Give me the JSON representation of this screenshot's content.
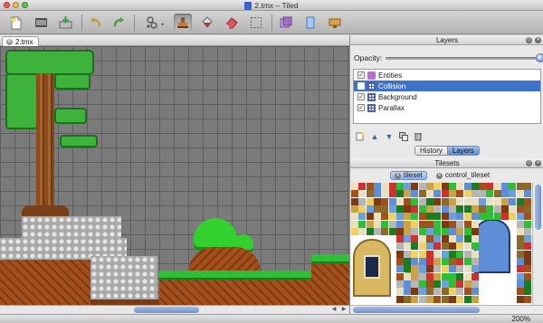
{
  "window": {
    "title": "2.tmx – Tiled",
    "traffic_lights": [
      "#ee5e57",
      "#f4bd4f",
      "#61c454"
    ]
  },
  "toolbar": {
    "tools": [
      {
        "name": "new-file-icon",
        "color": "#f3dc5e"
      },
      {
        "name": "open-file-icon",
        "color": "#4e4e4e"
      },
      {
        "name": "save-file-icon",
        "color": "#3aa04a"
      },
      {
        "name": "undo-icon",
        "color": "#c39c38"
      },
      {
        "name": "redo-icon",
        "color": "#4e9b3b"
      },
      {
        "name": "random-stamp-icon",
        "color": "#555555"
      },
      {
        "name": "stamp-brush-icon",
        "color": "#c97a2b"
      },
      {
        "name": "bucket-fill-icon",
        "color": "#c1343e"
      },
      {
        "name": "eraser-icon",
        "color": "#e2535c"
      },
      {
        "name": "rectangle-select-icon",
        "color": "#8a8a8a"
      },
      {
        "name": "select-objects-icon",
        "color": "#9b6ac2"
      },
      {
        "name": "insert-rectangle-icon",
        "color": "#6aa0dd"
      },
      {
        "name": "insert-tile-icon",
        "color": "#d8a24a"
      }
    ]
  },
  "document": {
    "tab_label": "2.tmx",
    "zoom": "200%"
  },
  "layers_panel": {
    "title": "Layers",
    "opacity_label": "Opacity:",
    "opacity_value": 1.0,
    "layers": [
      {
        "label": "Entities",
        "visible": true,
        "icon": "object-layer-icon",
        "selected": false
      },
      {
        "label": "Collision",
        "visible": false,
        "icon": "tile-layer-icon",
        "selected": true
      },
      {
        "label": "Background",
        "visible": true,
        "icon": "tile-layer-icon",
        "selected": false
      },
      {
        "label": "Parallax",
        "visible": true,
        "icon": "tile-layer-icon",
        "selected": false
      }
    ],
    "tabs": [
      "History",
      "Layers"
    ],
    "active_tab": "Layers"
  },
  "tilesets_panel": {
    "title": "Tilesets",
    "tabs": [
      "tileset",
      "control_tileset"
    ],
    "active_tab": "tileset"
  },
  "colors": {
    "selection": "#3e73c9",
    "grass": "#2fbf36",
    "dirt": "#a24f1c",
    "stone": "#b6b6b6",
    "trunk": "#8a4b1c",
    "leaf": "#3db33b"
  }
}
